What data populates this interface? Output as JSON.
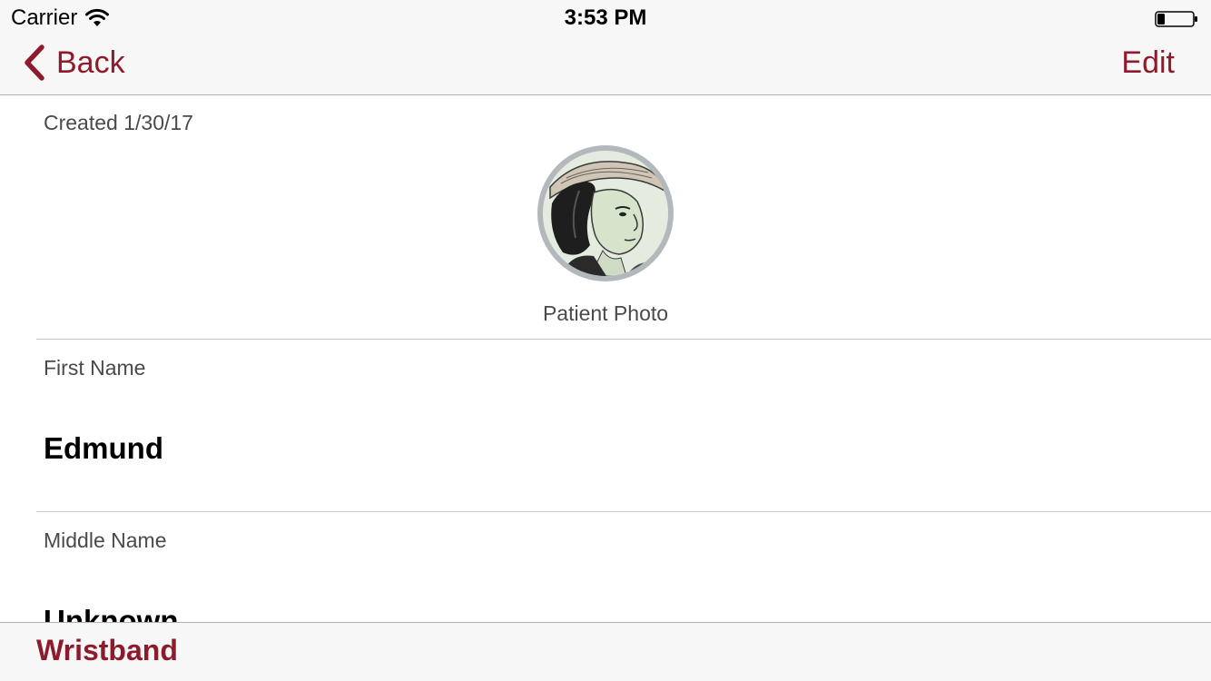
{
  "status_bar": {
    "carrier": "Carrier",
    "time": "3:53 PM",
    "wifi_icon": "wifi-icon",
    "battery_icon": "battery-icon"
  },
  "nav": {
    "back_label": "Back",
    "edit_label": "Edit",
    "back_icon": "chevron-left-icon"
  },
  "record": {
    "created": "Created 1/30/17",
    "photo_caption": "Patient Photo",
    "fields": [
      {
        "label": "First Name",
        "value": "Edmund"
      },
      {
        "label": "Middle Name",
        "value": "Unknown"
      }
    ]
  },
  "toolbar": {
    "wristband_label": "Wristband"
  },
  "colors": {
    "accent": "#8e1b2c",
    "bar_background": "#f7f7f7",
    "label_text": "#4a4a4a"
  }
}
